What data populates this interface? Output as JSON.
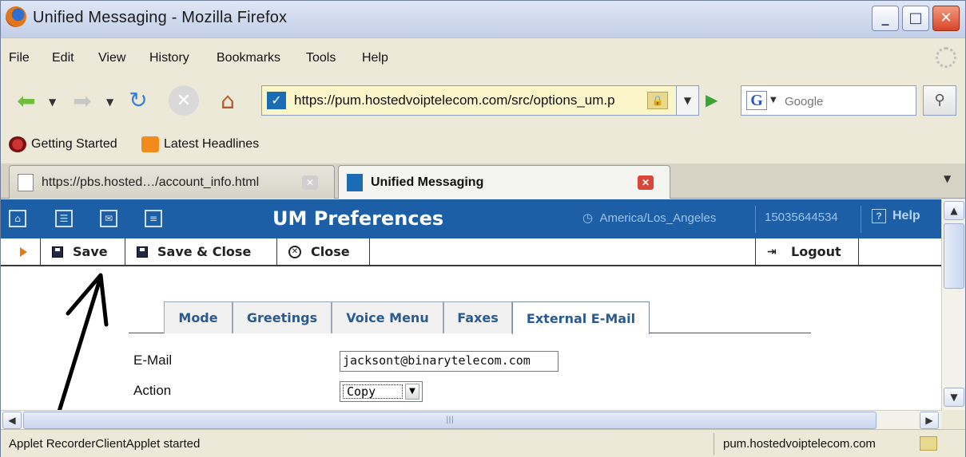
{
  "window": {
    "title": "Unified Messaging - Mozilla Firefox"
  },
  "menu": [
    "File",
    "Edit",
    "View",
    "History",
    "Bookmarks",
    "Tools",
    "Help"
  ],
  "navbar": {
    "url": "https://pum.hostedvoiptelecom.com/src/options_um.p",
    "search_placeholder": "Google"
  },
  "bookmarks": [
    "Getting Started",
    "Latest Headlines"
  ],
  "tabs": [
    {
      "label": "https://pbs.hosted…/account_info.html"
    },
    {
      "label": "Unified Messaging"
    }
  ],
  "um": {
    "title": "UM Preferences",
    "timezone": "America/Los_Angeles",
    "account": "15035644534",
    "help": "Help"
  },
  "toolbar": {
    "save": "Save",
    "save_close": "Save & Close",
    "close": "Close",
    "logout": "Logout"
  },
  "pref_tabs": [
    "Mode",
    "Greetings",
    "Voice Menu",
    "Faxes",
    "External E-Mail"
  ],
  "form": {
    "email_label": "E-Mail",
    "email_value": "jacksont@binarytelecom.com",
    "action_label": "Action",
    "action_value": "Copy"
  },
  "status": {
    "text": "Applet RecorderClientApplet started",
    "host": "pum.hostedvoiptelecom.com"
  },
  "colors": {
    "um_header": "#1d5fa6",
    "tab_text": "#2a5a92"
  }
}
